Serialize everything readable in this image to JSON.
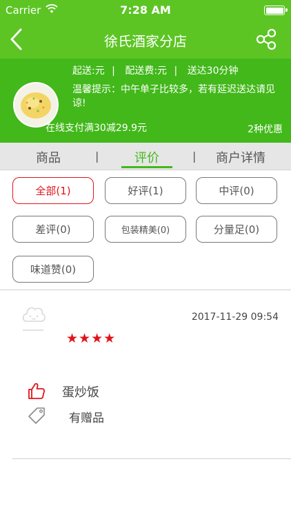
{
  "status_bar": {
    "carrier": "Carrier",
    "time": "7:28 AM"
  },
  "nav": {
    "title": "徐氏酒家分店",
    "back_icon": "chevron-left-icon",
    "share_icon": "share-icon"
  },
  "shop": {
    "min_order": "起送:元",
    "delivery_fee": "配送费:元",
    "delivery_time": "送达30分钟",
    "tip": "温馨提示：中午单子比较多，若有延迟送达请见谅!",
    "promo": "在线支付满30减29.9元",
    "discount_count": "2种优惠"
  },
  "tabs": [
    {
      "label": "商品"
    },
    {
      "label": "评价",
      "active": true
    },
    {
      "label": "商户详情"
    }
  ],
  "tab_separator": "|",
  "filters": [
    {
      "label": "全部(1)",
      "active": true
    },
    {
      "label": "好评(1)"
    },
    {
      "label": "中评(0)"
    },
    {
      "label": "差评(0)"
    },
    {
      "label": "包装精美(0)"
    },
    {
      "label": "分量足(0)"
    },
    {
      "label": "味道赞(0)"
    }
  ],
  "review": {
    "avatar_icon": "default-avatar-icon",
    "date": "2017-11-29 09:54",
    "stars": "★★★★",
    "rating": 4,
    "dish": "蛋炒饭",
    "gift": "有赠品"
  },
  "colors": {
    "primary": "#5cc524",
    "header": "#42b81a",
    "accent": "#e0141a"
  }
}
